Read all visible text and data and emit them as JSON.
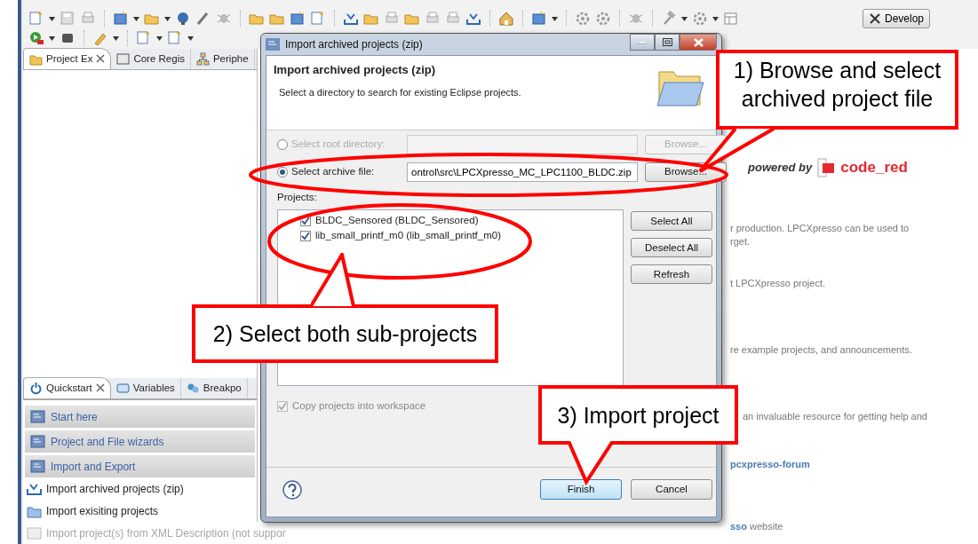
{
  "toolbar": {
    "perspective_button": "Develop"
  },
  "explorer_tabs": [
    {
      "label": "Project Ex",
      "selected": true
    },
    {
      "label": "Core Regis",
      "selected": false
    },
    {
      "label": "Periphe",
      "selected": false
    }
  ],
  "quickstart": {
    "tabs": [
      {
        "label": "Quickstart",
        "selected": true
      },
      {
        "label": "Variables",
        "selected": false
      },
      {
        "label": "Breakpo",
        "selected": false
      }
    ],
    "sections": [
      "Start here",
      "Project and File wizards",
      "Import and Export"
    ],
    "items": [
      {
        "label": "Import archived projects (zip)",
        "disabled": false
      },
      {
        "label": "Import exisiting projects",
        "disabled": false
      },
      {
        "label": "Import project(s) from XML Description (not suppor",
        "disabled": true
      }
    ]
  },
  "welcome": {
    "logo_prefix": "powered by",
    "logo": "code_red",
    "lines": [
      {
        "kind": "text",
        "text": "r production. LPCXpresso can be used to"
      },
      {
        "kind": "text",
        "text": "rget."
      },
      {
        "kind": "text",
        "text": "t LPCXpresso project."
      },
      {
        "kind": "text",
        "text": "re example projects, and announcements."
      },
      {
        "kind": "text",
        "text": "an invaluable resource for getting help and"
      },
      {
        "kind": "link",
        "text": "pcxpresso-forum"
      },
      {
        "kind": "link_text",
        "link": "sso",
        "text": "website"
      }
    ]
  },
  "dialog": {
    "title": "Import archived projects (zip)",
    "heading": "Import archived projects (zip)",
    "description": "Select a directory to search for existing Eclipse projects.",
    "sources": [
      {
        "label": "Select root directory:",
        "selected": false,
        "disabled": true,
        "button": "Browse..."
      },
      {
        "label": "Select archive file:",
        "selected": true,
        "disabled": false,
        "value": "ontrol\\src\\LPCXpresso_MC_LPC1100_BLDC.zip",
        "button": "Browse..."
      }
    ],
    "projects_label": "Projects:",
    "projects": [
      {
        "label": "BLDC_Sensored (BLDC_Sensored)",
        "checked": true
      },
      {
        "label": "lib_small_printf_m0 (lib_small_printf_m0)",
        "checked": true
      }
    ],
    "side_buttons": [
      "Select All",
      "Deselect All",
      "Refresh"
    ],
    "copy_option": {
      "label": "Copy projects into workspace",
      "checked": true,
      "disabled": true
    },
    "buttons": [
      {
        "label": "Finish",
        "default": true
      },
      {
        "label": "Cancel",
        "default": false
      }
    ]
  },
  "annotations": [
    {
      "text": "1) Browse and select archived project file"
    },
    {
      "text": "2) Select both sub-projects"
    },
    {
      "text": "3) Import project"
    }
  ]
}
